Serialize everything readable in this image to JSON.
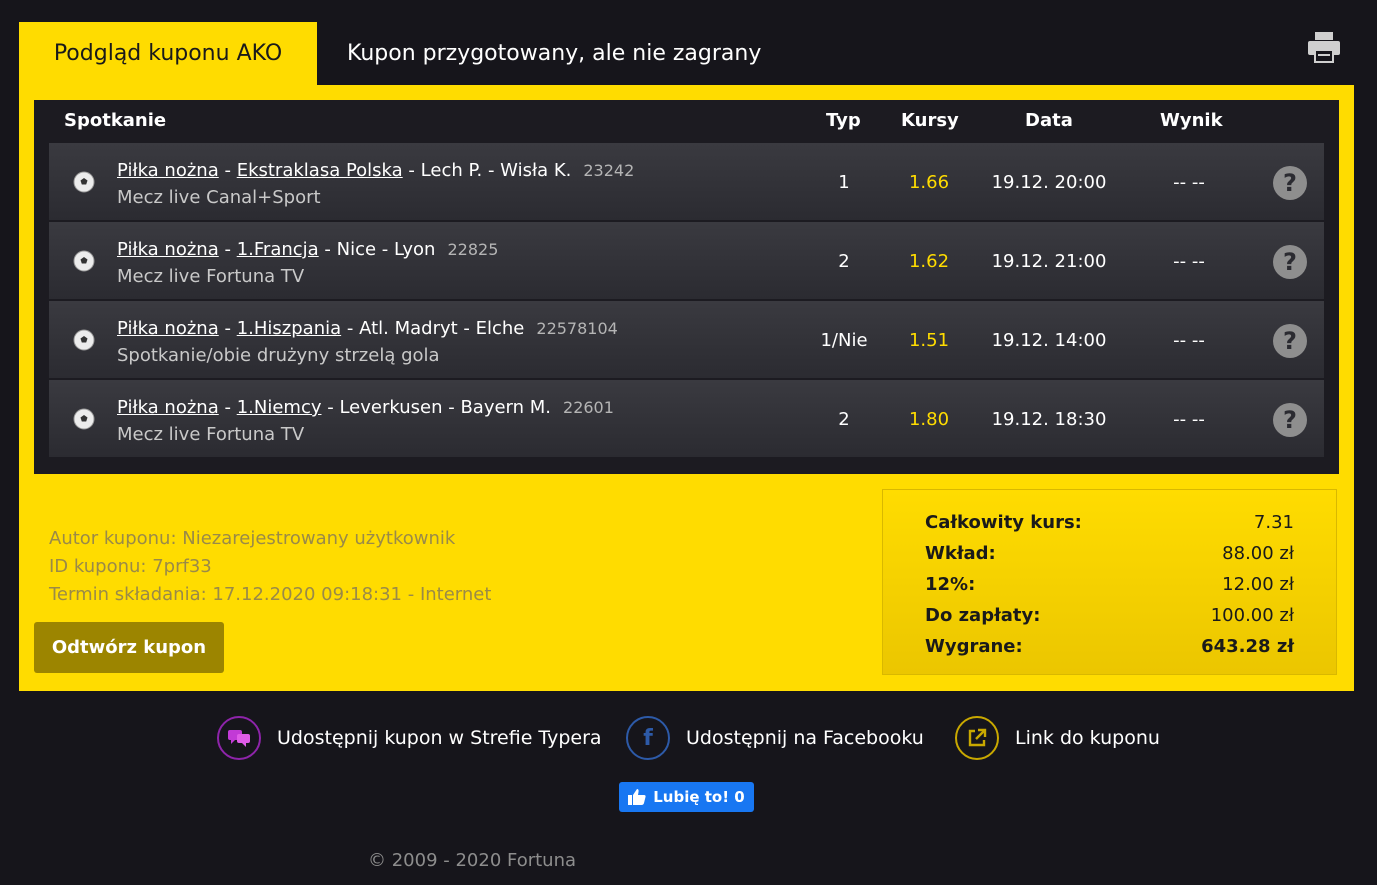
{
  "tabs": {
    "active": "Podgląd kuponu AKO",
    "status": "Kupon przygotowany, ale nie zagrany"
  },
  "table": {
    "headers": {
      "match": "Spotkanie",
      "type": "Typ",
      "odds": "Kursy",
      "date": "Data",
      "result": "Wynik"
    },
    "rows": [
      {
        "sport": "Piłka nożna",
        "league": "Ekstraklasa Polska",
        "teams": "Lech P. - Wisła K.",
        "event_id": "23242",
        "sub": "Mecz live Canal+Sport",
        "type": "1",
        "odds": "1.66",
        "date": "19.12. 20:00",
        "result": "-- --"
      },
      {
        "sport": "Piłka nożna",
        "league": "1.Francja",
        "teams": "Nice - Lyon",
        "event_id": "22825",
        "sub": "Mecz live Fortuna TV",
        "type": "2",
        "odds": "1.62",
        "date": "19.12. 21:00",
        "result": "-- --"
      },
      {
        "sport": "Piłka nożna",
        "league": "1.Hiszpania",
        "teams": "Atl. Madryt - Elche",
        "event_id": "22578104",
        "sub": "Spotkanie/obie drużyny strzelą gola",
        "type": "1/Nie",
        "odds": "1.51",
        "date": "19.12. 14:00",
        "result": "-- --"
      },
      {
        "sport": "Piłka nożna",
        "league": "1.Niemcy",
        "teams": "Leverkusen - Bayern M.",
        "event_id": "22601",
        "sub": "Mecz live Fortuna TV",
        "type": "2",
        "odds": "1.80",
        "date": "19.12. 18:30",
        "result": "-- --"
      }
    ]
  },
  "meta": {
    "author": "Autor kuponu: Niezarejestrowany użytkownik",
    "id": "ID kuponu: 7prf33",
    "deadline": "Termin składania: 17.12.2020 09:18:31 - Internet"
  },
  "restore_label": "Odtwórz kupon",
  "summary": {
    "total_odds_label": "Całkowity kurs:",
    "total_odds": "7.31",
    "stake_label": "Wkład:",
    "stake": "88.00 zł",
    "tax_label": "12%:",
    "tax": "12.00 zł",
    "pay_label": "Do zapłaty:",
    "pay": "100.00 zł",
    "win_label": "Wygrane:",
    "win": "643.28 zł"
  },
  "share": {
    "zone": "Udostępnij kupon w Strefie Typera",
    "facebook": "Udostępnij na Facebooku",
    "link": "Link do kuponu"
  },
  "like_label": "Lubię to! 0",
  "copyright": "© 2009 - 2020 Fortuna",
  "colors": {
    "accent": "#ffdc00",
    "background": "#16151b",
    "odds": "#ffdc00",
    "zone": "#8e24aa",
    "facebook": "#2d5aa8",
    "link": "#c9a800"
  },
  "icons": {
    "print": "printer-icon",
    "ball": "football-icon",
    "help": "question-icon",
    "zone": "chat-icon",
    "facebook": "facebook-icon",
    "link": "external-link-icon",
    "like": "thumbs-up-icon"
  }
}
